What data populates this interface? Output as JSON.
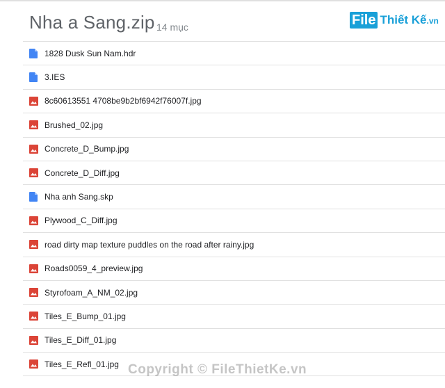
{
  "header": {
    "title": "Nha a Sang.zip",
    "item_count": "14 mục"
  },
  "watermark": {
    "logo": "File",
    "brand": "Thiết Kế",
    "suffix": ".vn"
  },
  "files": [
    {
      "name": "1828 Dusk Sun Nam.hdr",
      "icon": "doc-icon"
    },
    {
      "name": "3.IES",
      "icon": "doc-icon"
    },
    {
      "name": "8c60613551 4708be9b2bf6942f76007f.jpg",
      "icon": "image-icon"
    },
    {
      "name": "Brushed_02.jpg",
      "icon": "image-icon"
    },
    {
      "name": "Concrete_D_Bump.jpg",
      "icon": "image-icon"
    },
    {
      "name": "Concrete_D_Diff.jpg",
      "icon": "image-icon"
    },
    {
      "name": "Nha anh Sang.skp",
      "icon": "doc-icon"
    },
    {
      "name": "Plywood_C_Diff.jpg",
      "icon": "image-icon"
    },
    {
      "name": "road dirty map texture puddles on the road after rainy.jpg",
      "icon": "image-icon"
    },
    {
      "name": "Roads0059_4_preview.jpg",
      "icon": "image-icon"
    },
    {
      "name": "Styrofoam_A_NM_02.jpg",
      "icon": "image-icon"
    },
    {
      "name": "Tiles_E_Bump_01.jpg",
      "icon": "image-icon"
    },
    {
      "name": "Tiles_E_Diff_01.jpg",
      "icon": "image-icon"
    },
    {
      "name": "Tiles_E_Refl_01.jpg",
      "icon": "image-icon"
    }
  ],
  "footer": {
    "copyright": "Copyright © FileThietKe.vn"
  },
  "colors": {
    "doc_icon": "#4285f4",
    "image_icon": "#db4437",
    "watermark": "#19a0d8"
  }
}
